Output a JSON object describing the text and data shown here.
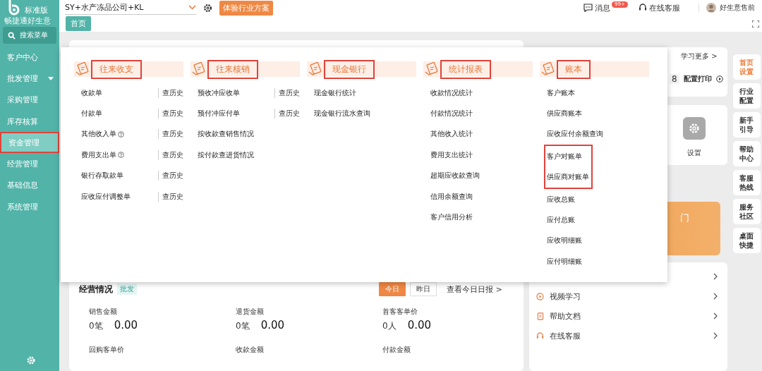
{
  "sidebar": {
    "logo_text": "畅捷通好生意",
    "edition": "标准版",
    "search_label": "搜索菜单",
    "items": [
      {
        "label": "客户中心",
        "selected": false,
        "has_submenu": false,
        "highlighted": false
      },
      {
        "label": "批发管理",
        "selected": false,
        "has_submenu": true,
        "highlighted": false
      },
      {
        "label": "采购管理",
        "selected": false,
        "has_submenu": false,
        "highlighted": false
      },
      {
        "label": "库存核算",
        "selected": false,
        "has_submenu": false,
        "highlighted": false
      },
      {
        "label": "资金管理",
        "selected": true,
        "has_submenu": false,
        "highlighted": true
      },
      {
        "label": "经营管理",
        "selected": false,
        "has_submenu": false,
        "highlighted": false
      },
      {
        "label": "基础信息",
        "selected": false,
        "has_submenu": false,
        "highlighted": false
      },
      {
        "label": "系统管理",
        "selected": false,
        "has_submenu": false,
        "highlighted": false
      }
    ]
  },
  "top_bar": {
    "company": "SY+水产冻品公司+KL",
    "trial_button": "体验行业方案",
    "messages": "消息",
    "messages_badge": "99+",
    "support": "在线客服",
    "user": "好生意售前"
  },
  "tabs": [
    {
      "label": "首页",
      "selected": true
    }
  ],
  "menu_panel": {
    "groups": [
      {
        "title": "往来收支",
        "highlighted": true,
        "items": [
          {
            "label": "收款单",
            "help": false,
            "history_link": "查历史",
            "highlighted": false
          },
          {
            "label": "付款单",
            "help": false,
            "history_link": "查历史",
            "highlighted": false
          },
          {
            "label": "其他收入单",
            "help": true,
            "history_link": "查历史",
            "highlighted": false
          },
          {
            "label": "费用支出单",
            "help": true,
            "history_link": "查历史",
            "highlighted": false
          },
          {
            "label": "银行存取款单",
            "help": false,
            "history_link": "查历史",
            "highlighted": false
          },
          {
            "label": "应收应付调整单",
            "help": false,
            "history_link": "查历史",
            "highlighted": false
          }
        ]
      },
      {
        "title": "往来核销",
        "highlighted": true,
        "items": [
          {
            "label": "预收冲应收单",
            "help": false,
            "history_link": "查历史",
            "highlighted": false
          },
          {
            "label": "预付冲应付单",
            "help": false,
            "history_link": "查历史",
            "highlighted": false
          },
          {
            "label": "按收款查销售情况",
            "help": false,
            "highlighted": false
          },
          {
            "label": "按付款查进货情况",
            "help": false,
            "highlighted": false
          }
        ]
      },
      {
        "title": "现金银行",
        "highlighted": true,
        "items": [
          {
            "label": "现金银行统计",
            "help": false,
            "highlighted": false
          },
          {
            "label": "现金银行流水查询",
            "help": false,
            "highlighted": false
          }
        ]
      },
      {
        "title": "统计报表",
        "highlighted": true,
        "items": [
          {
            "label": "收款情况统计",
            "help": false,
            "highlighted": false
          },
          {
            "label": "付款情况统计",
            "help": false,
            "highlighted": false
          },
          {
            "label": "其他收入统计",
            "help": false,
            "highlighted": false
          },
          {
            "label": "费用支出统计",
            "help": false,
            "highlighted": false
          },
          {
            "label": "超期应收款查询",
            "help": false,
            "highlighted": false
          },
          {
            "label": "信用余额查询",
            "help": false,
            "highlighted": false
          },
          {
            "label": "客户信用分析",
            "help": false,
            "highlighted": false
          }
        ]
      },
      {
        "title": "账本",
        "highlighted": true,
        "items": [
          {
            "label": "客户账本",
            "help": false,
            "highlighted": false
          },
          {
            "label": "供应商账本",
            "help": false,
            "highlighted": false
          },
          {
            "label": "应收应付余额查询",
            "help": false,
            "highlighted": false
          },
          {
            "label": "客户对账单",
            "help": false,
            "highlighted": true
          },
          {
            "label": "供应商对账单",
            "help": false,
            "highlighted": true
          },
          {
            "label": "应收总账",
            "help": false,
            "highlighted": false
          },
          {
            "label": "应付总账",
            "help": false,
            "highlighted": false
          },
          {
            "label": "应收明细账",
            "help": false,
            "highlighted": false
          },
          {
            "label": "应付明细账",
            "help": false,
            "highlighted": false
          }
        ]
      }
    ]
  },
  "business_card": {
    "title": "经营情况",
    "tag": "批发",
    "periods": [
      {
        "label": "今日",
        "selected": true
      },
      {
        "label": "昨日",
        "selected": false
      }
    ],
    "report_link": "查看今日日报 >",
    "metrics": [
      {
        "label": "销售金额",
        "count": "0笔",
        "amount": "0.00"
      },
      {
        "label": "退货金额",
        "count": "0笔",
        "amount": "0.00"
      },
      {
        "label": "首客客单价",
        "count": "0人",
        "amount": "0.00"
      },
      {
        "label": "回购客单价"
      },
      {
        "label": "收款金额"
      },
      {
        "label": "付款金额"
      }
    ]
  },
  "right_panel": {
    "learn_more": "学习更多 >",
    "print_count": "8",
    "print_config": "配置打印",
    "settings_label": "设置",
    "banner_text": "门",
    "links": [
      "视频学习",
      "帮助文档",
      "在线客服"
    ]
  },
  "right_rail": [
    {
      "label": "首页设置",
      "selected": true
    },
    {
      "label": "行业配置",
      "selected": false
    },
    {
      "label": "新手引导",
      "selected": false
    },
    {
      "label": "帮助中心",
      "selected": false
    },
    {
      "label": "客服热线",
      "selected": false
    },
    {
      "label": "服务社区",
      "selected": false
    },
    {
      "label": "桌面快捷",
      "selected": false
    }
  ]
}
